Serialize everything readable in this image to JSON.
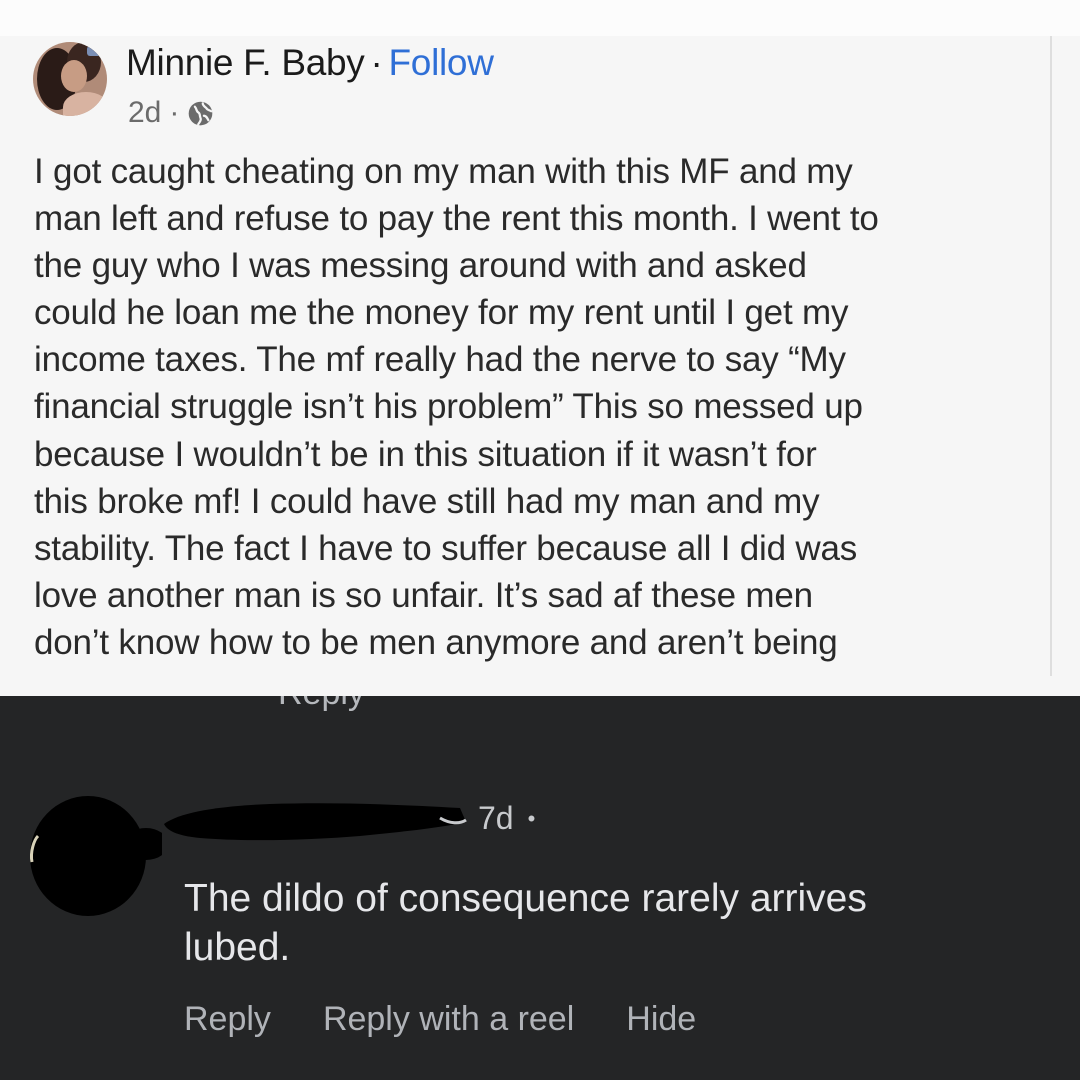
{
  "post": {
    "author": "Minnie F. Baby",
    "separator": "·",
    "follow_label": "Follow",
    "timestamp": "2d",
    "meta_separator": "·",
    "audience_icon": "globe-icon",
    "text_lines": [
      "I got caught cheating on my man with this MF and my",
      "man left and refuse to pay the rent this month. I went to",
      "the guy who I was messing around with and asked",
      "could he loan me the money for my rent until I get my",
      "income taxes. The mf really had the nerve to say “My",
      "financial struggle isn’t his problem” This so messed up",
      "because I wouldn’t be in this situation if it wasn’t for",
      "this broke mf! I could have still had my man and my",
      "stability. The fact I have to suffer because all I did was",
      "love another man is so unfair. It’s sad af these men",
      "don’t know how to be men anymore and aren’t being"
    ],
    "cut_word": "Reply"
  },
  "comment": {
    "timestamp": "7d",
    "bullet": "•",
    "text_lines": [
      "The dildo of consequence rarely arrives",
      "lubed."
    ],
    "actions": {
      "reply": "Reply",
      "reply_with_reel": "Reply with a reel",
      "hide": "Hide"
    }
  },
  "colors": {
    "follow_link": "#2f6fd6",
    "dark_panel": "#242526",
    "comment_text": "#e6e7ea",
    "action_text": "#b0b3b8"
  }
}
